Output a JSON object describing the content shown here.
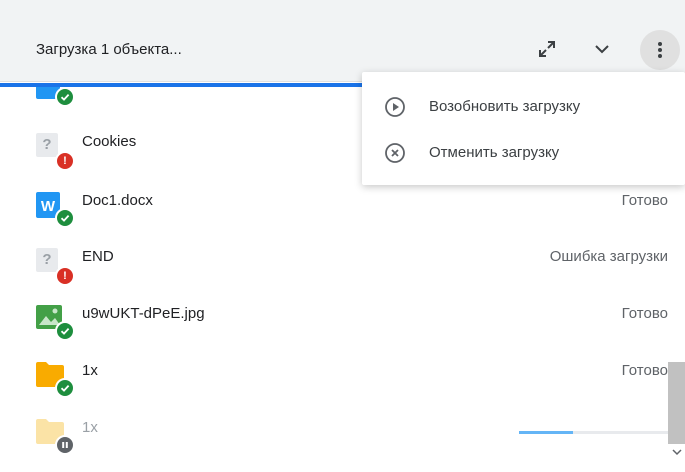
{
  "header": {
    "title": "Загрузка 1 объекта...",
    "expand_icon": "expand-icon",
    "collapse_icon": "chevron-down-icon",
    "more_icon": "more-vert-icon"
  },
  "menu": {
    "items": [
      {
        "label": "Возобновить загрузку",
        "icon": "play-circle-icon"
      },
      {
        "label": "Отменить загрузку",
        "icon": "cancel-circle-icon"
      }
    ]
  },
  "files": [
    {
      "name": "Cookies",
      "status": "",
      "type": "unknown",
      "badge": "error"
    },
    {
      "name": "Doc1.docx",
      "status": "Готово",
      "type": "word",
      "badge": "success"
    },
    {
      "name": "END",
      "status": "Ошибка загрузки",
      "type": "unknown",
      "badge": "error"
    },
    {
      "name": "u9wUKT-dPeE.jpg",
      "status": "Готово",
      "type": "image",
      "badge": "success"
    },
    {
      "name": "1x",
      "status": "Готово",
      "type": "folder",
      "badge": "success"
    },
    {
      "name": "1x",
      "status": "",
      "type": "folder",
      "badge": "paused",
      "progress": 0.36
    }
  ],
  "colors": {
    "accent": "#1a73e8",
    "success": "#1e8e3e",
    "error": "#d93025",
    "folder": "#f9ab00",
    "word": "#2196f3",
    "image": "#43a047"
  }
}
